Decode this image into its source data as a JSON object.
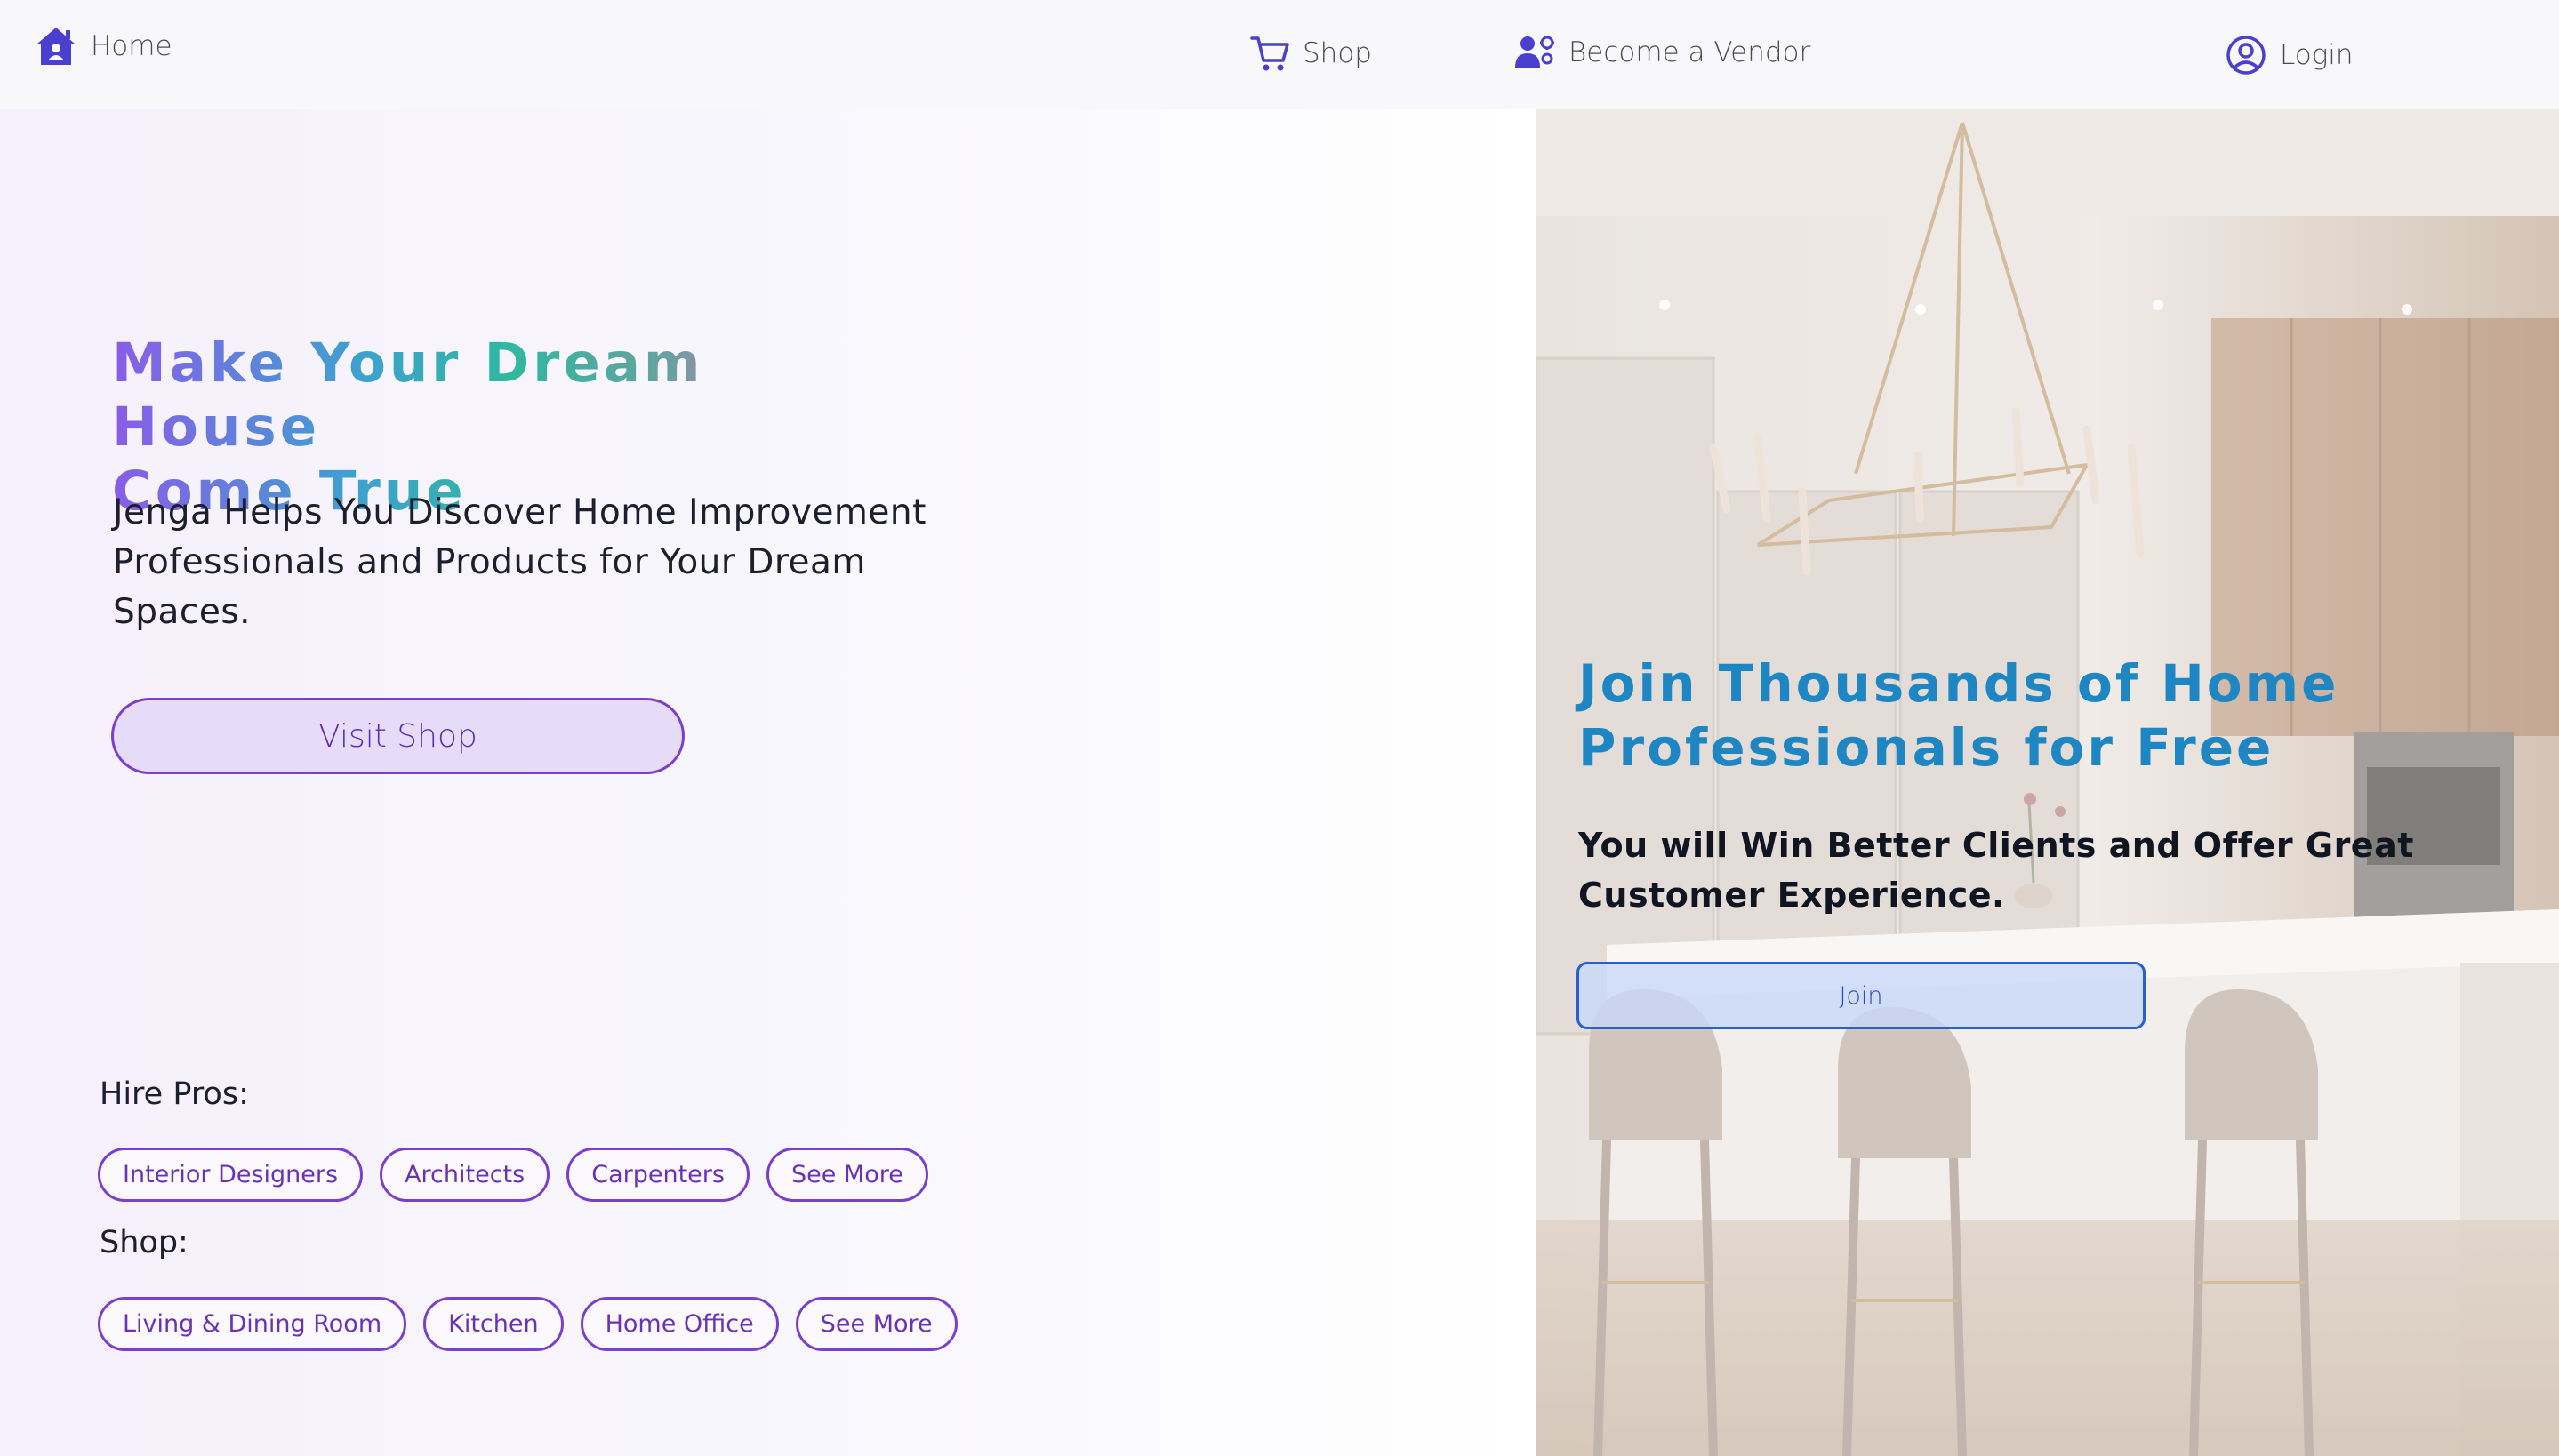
{
  "nav": {
    "home_label": "Home",
    "shop_label": "Shop",
    "vendor_label": "Become a Vendor",
    "login_label": "Login",
    "icons": {
      "home": "house-icon",
      "shop": "cart-icon",
      "vendor": "vendor-gear-icon",
      "login": "user-circle-icon"
    },
    "icon_color": "#4b3fcf"
  },
  "hero": {
    "headline_line1": "Make Your Dream House",
    "headline_line2": "Come True",
    "subtext": "Jenga Helps You Discover Home Improvement Professionals and Products for Your Dream Spaces.",
    "visit_button": "Visit Shop"
  },
  "hire": {
    "label": "Hire Pros:",
    "pills": [
      "Interior Designers",
      "Architects",
      "Carpenters",
      "See More"
    ]
  },
  "shop": {
    "label": "Shop:",
    "pills": [
      "Living & Dining Room",
      "Kitchen",
      "Home Office",
      "See More"
    ]
  },
  "vendor_panel": {
    "title": "Join Thousands of Home Professionals for Free",
    "subtitle": "You will Win Better Clients and Offer Great Customer Experience.",
    "join_button": "Join"
  },
  "colors": {
    "accent_purple": "#7a3fcc",
    "accent_blue": "#1f86c4",
    "join_border": "#2a5fd0"
  }
}
